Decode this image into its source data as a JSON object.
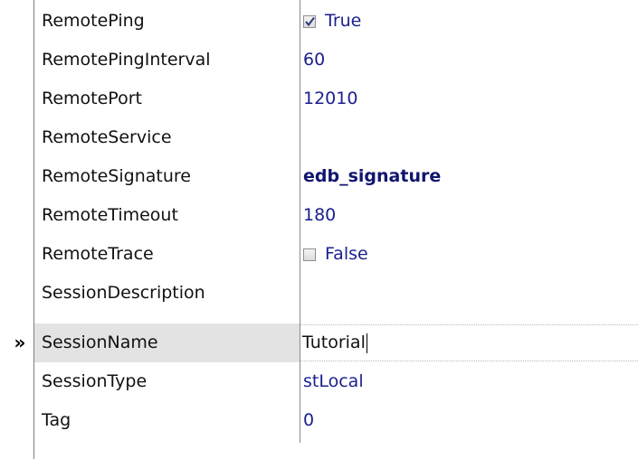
{
  "grid": {
    "selected_marker": "»",
    "rows": [
      {
        "name": "RemotePing",
        "value": "True",
        "checkbox": true,
        "checked": true
      },
      {
        "name": "RemotePingInterval",
        "value": "60"
      },
      {
        "name": "RemotePort",
        "value": "12010"
      },
      {
        "name": "RemoteService",
        "value": ""
      },
      {
        "name": "RemoteSignature",
        "value": "edb_signature",
        "bold": true
      },
      {
        "name": "RemoteTimeout",
        "value": "180"
      },
      {
        "name": "RemoteTrace",
        "value": "False",
        "checkbox": true,
        "checked": false
      },
      {
        "name": "SessionDescription",
        "value": ""
      },
      {
        "name": "SessionName",
        "value": "Tutorial",
        "selected": true,
        "editing": true
      },
      {
        "name": "SessionType",
        "value": "stLocal"
      },
      {
        "name": "Tag",
        "value": "0"
      }
    ]
  }
}
